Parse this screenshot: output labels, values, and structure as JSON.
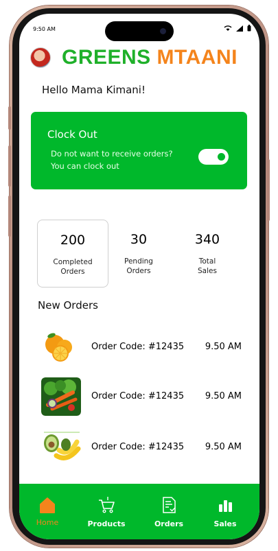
{
  "status_bar": {
    "time": "9:50 AM"
  },
  "header": {
    "logo_part1": "GREENS",
    "logo_part2": "MTAANI"
  },
  "greeting": "Hello Mama Kimani!",
  "clock_card": {
    "title": "Clock Out",
    "line1": "Do not want to receive orders?",
    "line2": "You can clock out",
    "toggle_on": true
  },
  "stats": [
    {
      "value": "200",
      "label1": "Completed",
      "label2": "Orders"
    },
    {
      "value": "30",
      "label1": "Pending",
      "label2": "Orders"
    },
    {
      "value": "340",
      "label1": "Total",
      "label2": "Sales"
    }
  ],
  "new_orders": {
    "title": "New Orders",
    "items": [
      {
        "code": "Order Code: #12435",
        "time": "9.50 AM",
        "image": "oranges"
      },
      {
        "code": "Order Code: #12435",
        "time": "9.50 AM",
        "image": "vegetables"
      },
      {
        "code": "Order Code: #12435",
        "time": "9.50 AM",
        "image": "avocado-bananas"
      }
    ]
  },
  "tabs": [
    {
      "label": "Home",
      "icon": "home-icon",
      "active": true
    },
    {
      "label": "Products",
      "icon": "cart-icon",
      "active": false
    },
    {
      "label": "Orders",
      "icon": "document-icon",
      "active": false
    },
    {
      "label": "Sales",
      "icon": "bar-chart-icon",
      "active": false
    }
  ],
  "colors": {
    "brand_green": "#00b82b",
    "logo_green": "#1fb02a",
    "accent_orange": "#f4841c"
  }
}
